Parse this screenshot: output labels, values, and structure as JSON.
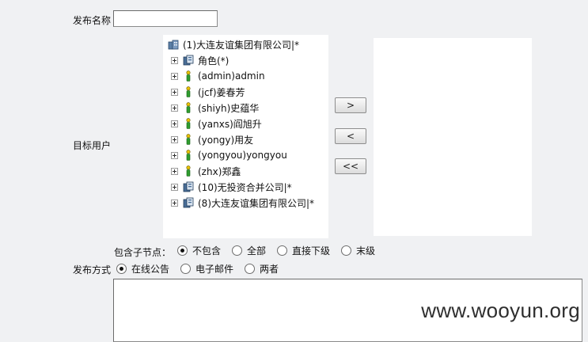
{
  "form": {
    "publish_name_label": "发布名称",
    "publish_name_value": "",
    "target_users_label": "目标用户",
    "include_children_label": "包含子节点：",
    "publish_method_label": "发布方式",
    "message_value": ""
  },
  "tree": {
    "root": "(1)大连友谊集团有限公司|*",
    "items": [
      {
        "label": "角色(*)",
        "icon": "role-icon"
      },
      {
        "label": "(admin)admin",
        "icon": "user-icon"
      },
      {
        "label": "(jcf)姜春芳",
        "icon": "user-icon"
      },
      {
        "label": "(shiyh)史蕴华",
        "icon": "user-icon"
      },
      {
        "label": "(yanxs)阎旭升",
        "icon": "user-icon"
      },
      {
        "label": "(yongy)用友",
        "icon": "user-icon"
      },
      {
        "label": "(yongyou)yongyou",
        "icon": "user-icon"
      },
      {
        "label": "(zhx)郑鑫",
        "icon": "user-icon"
      },
      {
        "label": "(10)无投资合并公司|*",
        "icon": "company-icon"
      },
      {
        "label": "(8)大连友谊集团有限公司|*",
        "icon": "company-icon"
      }
    ]
  },
  "buttons": {
    "add": ">",
    "remove": "<",
    "remove_all": "<<"
  },
  "include_options": [
    {
      "label": "不包含",
      "checked": true
    },
    {
      "label": "全部",
      "checked": false
    },
    {
      "label": "直接下级",
      "checked": false
    },
    {
      "label": "末级",
      "checked": false
    }
  ],
  "method_options": [
    {
      "label": "在线公告",
      "checked": true
    },
    {
      "label": "电子邮件",
      "checked": false
    },
    {
      "label": "两者",
      "checked": false
    }
  ],
  "watermark": "www.wooyun.org"
}
